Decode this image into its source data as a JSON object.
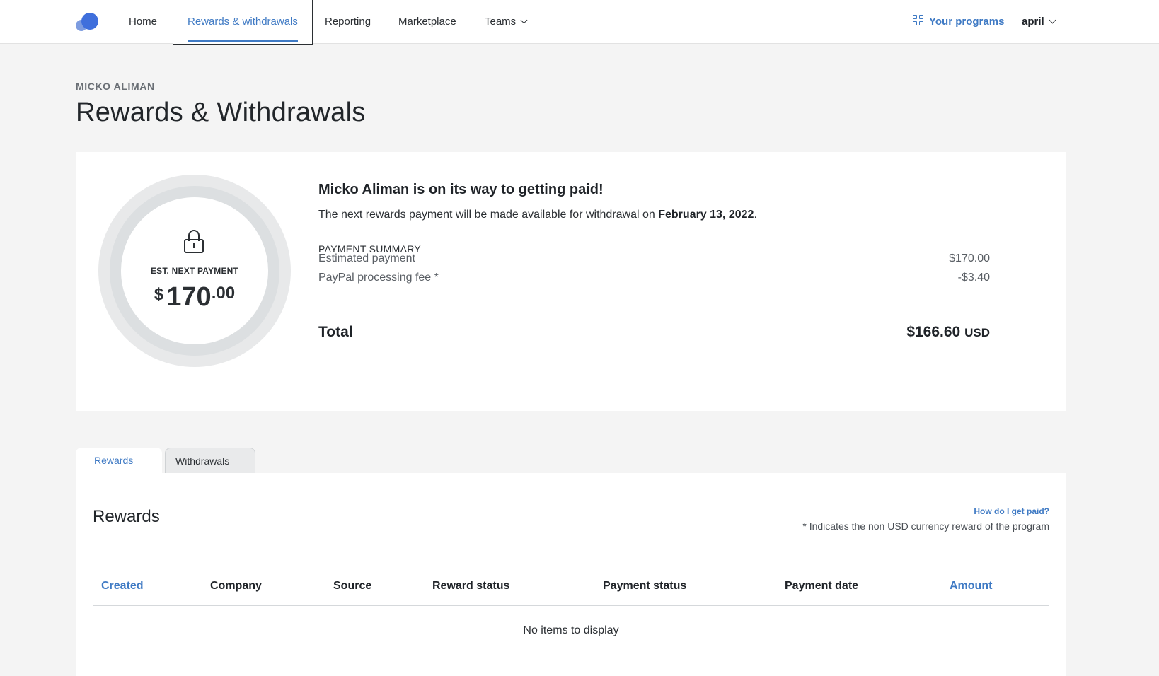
{
  "nav": {
    "items": [
      {
        "label": "Home"
      },
      {
        "label": "Rewards & withdrawals"
      },
      {
        "label": "Reporting"
      },
      {
        "label": "Marketplace"
      },
      {
        "label": "Teams"
      }
    ],
    "active_index": 1,
    "programs_label": "Your programs",
    "user_label": "april"
  },
  "header": {
    "owner": "MICKO ALIMAN",
    "title": "Rewards & Withdrawals"
  },
  "summary": {
    "est_label": "EST. NEXT PAYMENT",
    "est_currency": "$",
    "est_int": "170",
    "est_dec": ".00",
    "headline": "Micko Aliman is on its way to getting paid!",
    "subline_prefix": "The next rewards payment will be made available for withdrawal on ",
    "subline_date": "February 13, 2022",
    "subline_suffix": ".",
    "section_title": "PAYMENT SUMMARY",
    "rows": [
      {
        "label": "Estimated payment",
        "value": "$170.00"
      },
      {
        "label": "PayPal processing fee *",
        "value": "-$3.40"
      }
    ],
    "total_label": "Total",
    "total_value": "$166.60",
    "total_unit": "USD"
  },
  "tabs": [
    {
      "label": "Rewards"
    },
    {
      "label": "Withdrawals"
    }
  ],
  "rewards": {
    "title": "Rewards",
    "help_link": "How do I get paid?",
    "note": "* Indicates the non USD currency reward of the program",
    "columns": [
      "Created",
      "Company",
      "Source",
      "Reward status",
      "Payment status",
      "Payment date",
      "Amount"
    ],
    "empty_text": "No items to display"
  },
  "colors": {
    "accent": "#3f7ac4",
    "background": "#f4f4f4"
  }
}
